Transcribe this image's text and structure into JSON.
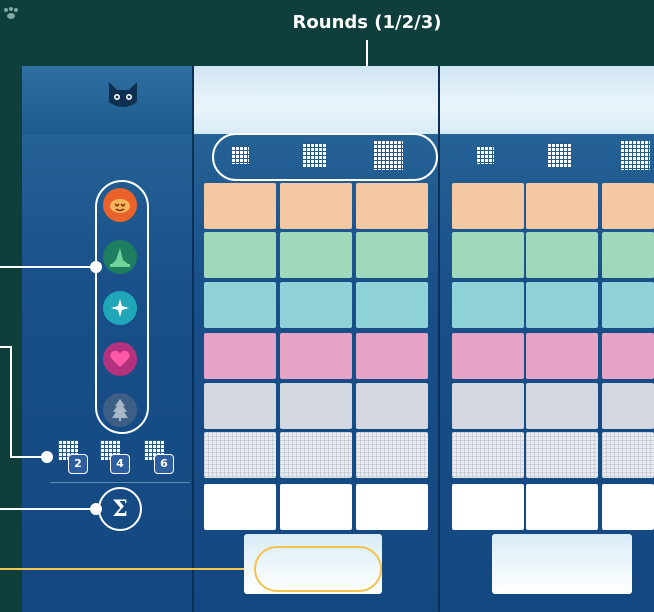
{
  "title": "Rounds (1/2/3)",
  "sum_symbol": "Σ",
  "bonus_values": [
    "2",
    "4",
    "6"
  ],
  "colors": {
    "orange": "#f4c8a3",
    "green": "#a0d8bc",
    "teal": "#8fd2d8",
    "pink": "#e5a3c8",
    "gray": "#d3d7df",
    "checker": "#e8ebf0",
    "white": "#ffffff",
    "highlight": "#f3c550",
    "board": "#19508a"
  },
  "category_icons": [
    "pumpkin-icon",
    "witch-hat-icon",
    "star-gem-icon",
    "heart-icon",
    "pine-tree-icon"
  ],
  "header_icon": "cat-face-icon"
}
